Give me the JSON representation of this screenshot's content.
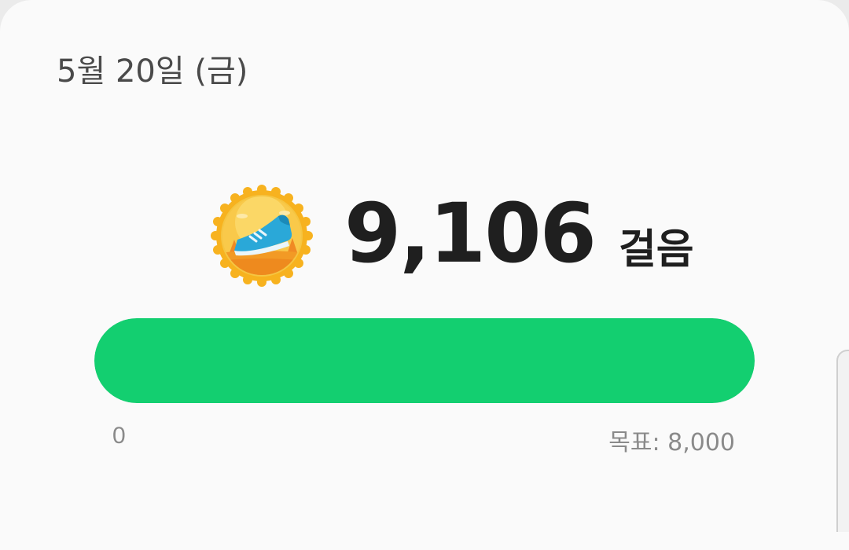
{
  "header": {
    "date": "5월 20일 (금)"
  },
  "steps": {
    "count": "9,106",
    "unit": "걸음",
    "badge_icon": "running-shoe-badge-icon"
  },
  "progress": {
    "value": 9106,
    "goal": 8000,
    "fraction": 1.0,
    "min_label": "0",
    "goal_label": "목표: 8,000",
    "fill_color": "#13cf70",
    "track_color": "#e2e2e2"
  }
}
